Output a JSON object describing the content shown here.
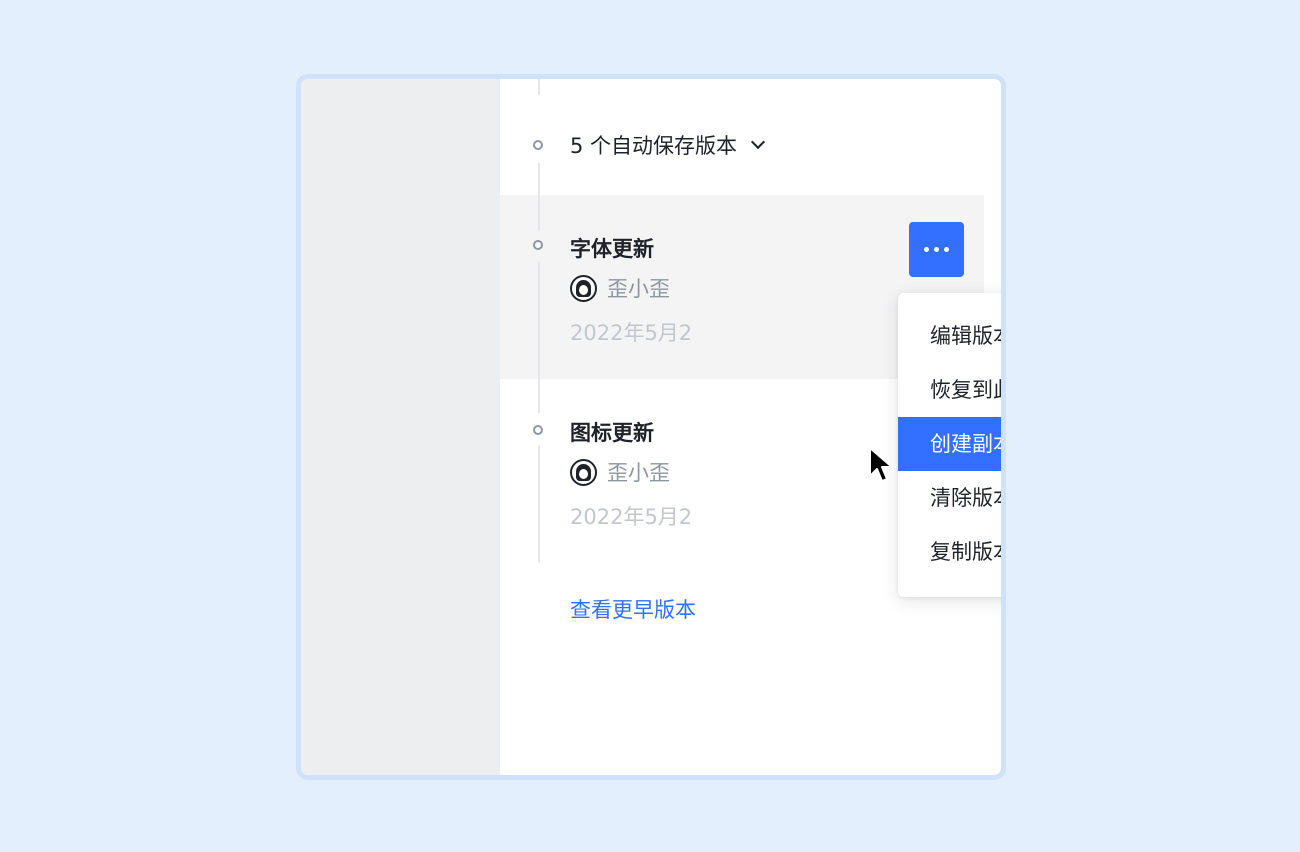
{
  "auto_saves": {
    "label": "5 个自动保存版本"
  },
  "versions": [
    {
      "title": "字体更新",
      "author": "歪小歪",
      "date": "2022年5月2"
    },
    {
      "title": "图标更新",
      "author": "歪小歪",
      "date": "2022年5月2"
    }
  ],
  "menu": {
    "items": [
      {
        "label": "编辑版本信息"
      },
      {
        "label": "恢复到此版本"
      },
      {
        "label": "创建副本"
      },
      {
        "label": "清除版本信息"
      },
      {
        "label": "复制版本链接"
      }
    ],
    "active_index": 2
  },
  "earlier_link": "查看更早版本",
  "colors": {
    "accent": "#3370ff",
    "page_bg": "#e3effd",
    "frame_border": "#cfe1fb",
    "left_panel": "#edeef0",
    "highlight_row": "#f4f4f5"
  },
  "icons": {
    "more": "more-horizontal-icon",
    "expand": "chevron-down-icon",
    "avatar": "user-avatar-icon",
    "pointer": "mouse-pointer-icon"
  }
}
